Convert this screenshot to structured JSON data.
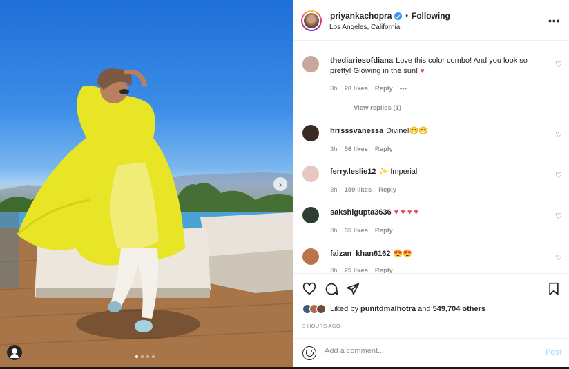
{
  "post": {
    "username": "priyankachopra",
    "separator": "•",
    "follow_status": "Following",
    "location": "Los Angeles, California"
  },
  "comments": [
    {
      "username": "thediariesofdiana",
      "text": "Love this color combo! And you look so pretty! Glowing in the sun!",
      "emoji": "♥",
      "time": "3h",
      "likes": "28 likes",
      "reply": "Reply",
      "more": "•••",
      "view_replies": "View replies (1)",
      "avatar_color": "#c9a89a"
    },
    {
      "username": "hrrsssvanessa",
      "text": "Divine!",
      "emoji": "😁😁",
      "time": "3h",
      "likes": "56 likes",
      "reply": "Reply",
      "avatar_color": "#3a2a24"
    },
    {
      "username": "ferry.leslie12",
      "text": "Imperial",
      "emoji": "✨",
      "time": "3h",
      "likes": "159 likes",
      "reply": "Reply",
      "avatar_color": "#e8c7c0"
    },
    {
      "username": "sakshigupta3636",
      "text": "",
      "emoji": "♥ ♥ ♥ ♥",
      "time": "3h",
      "likes": "35 likes",
      "reply": "Reply",
      "avatar_color": "#2e3d33"
    },
    {
      "username": "faizan_khan6162",
      "text": "",
      "emoji": "😍😍",
      "time": "3h",
      "likes": "25 likes",
      "reply": "Reply",
      "avatar_color": "#b8744a"
    }
  ],
  "actions": {
    "liked_by_prefix": "Liked by",
    "liked_by_user": "punitdmalhotra",
    "liked_by_suffix": "and",
    "others_count": "549,704 others",
    "time_ago": "3 HOURS AGO"
  },
  "add_comment": {
    "placeholder": "Add a comment...",
    "post_label": "Post"
  },
  "colors": {
    "accent": "#3897f0",
    "like_red": "#ed4956",
    "post_disabled": "#b2dffc",
    "dress_yellow": "#e8e426"
  },
  "icons": [
    "heart-icon",
    "comment-icon",
    "share-icon",
    "save-icon",
    "more-icon",
    "emoji-icon",
    "chevron-right-icon",
    "user-tag-icon",
    "verified-icon"
  ]
}
